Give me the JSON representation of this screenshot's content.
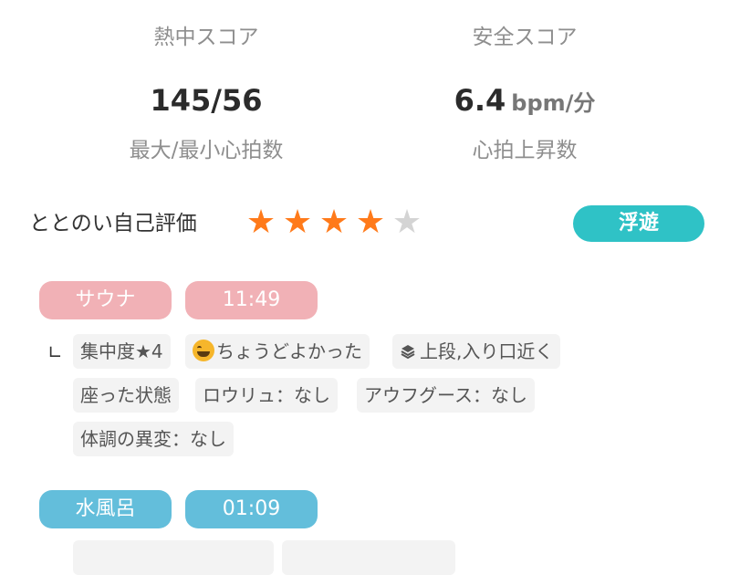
{
  "scores": {
    "heat_label": "熱中スコア",
    "safety_label": "安全スコア",
    "heart_rate": "145/56",
    "rise_value": "6.4",
    "rise_unit": "bpm/分",
    "heart_rate_label": "最大/最小心拍数",
    "rise_label": "心拍上昇数"
  },
  "rating": {
    "label": "ととのい自己評価",
    "stars_filled": 4,
    "stars_total": 5,
    "badge": "浮遊"
  },
  "sauna_session": {
    "type_label": "サウナ",
    "time": "11:49",
    "branch": "∟",
    "tags": [
      "集中度★4",
      "ちょうどよかった",
      "上段,入り口近く",
      "座った状態",
      "ロウリュ：なし",
      "アウフグース：なし",
      "体調の異変：なし"
    ]
  },
  "water_session": {
    "type_label": "水風呂",
    "time": "01:09"
  },
  "colors": {
    "star_on": "#ff7a1a",
    "star_off": "#d4d4d4",
    "badge": "#2fc2c6",
    "sauna": "#f1b1b6",
    "water": "#63bedb"
  },
  "icons": {
    "emoji": "grinning-face-icon",
    "position": "layers-icon"
  }
}
